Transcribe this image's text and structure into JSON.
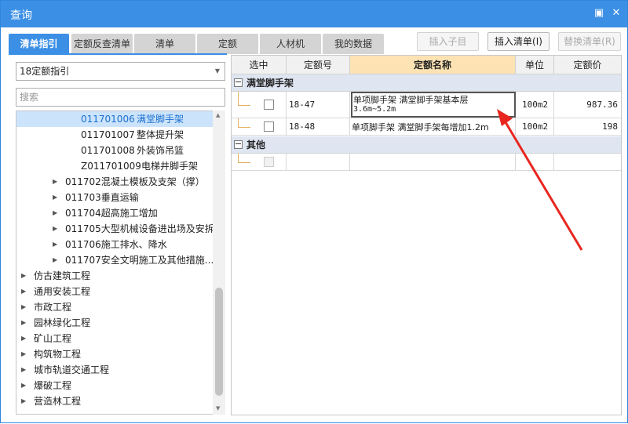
{
  "window": {
    "title": "查询",
    "minimize_icon": "minimize-icon",
    "close_icon": "close-icon"
  },
  "tabs": [
    {
      "label": "清单指引",
      "active": true
    },
    {
      "label": "定额反查清单",
      "active": false
    },
    {
      "label": "清单",
      "active": false
    },
    {
      "label": "定额",
      "active": false
    },
    {
      "label": "人材机",
      "active": false
    },
    {
      "label": "我的数据",
      "active": false
    }
  ],
  "actions": {
    "insert_child": "插入子目",
    "insert_list": "插入清单(I)",
    "replace_list": "替换清单(R)"
  },
  "left": {
    "select_value": "18定额指引",
    "search_placeholder": "搜索",
    "tree": [
      {
        "code": "011701006",
        "name": "满堂脚手架",
        "selected": true,
        "leaf": true
      },
      {
        "code": "011701007",
        "name": "整体提升架",
        "leaf": true
      },
      {
        "code": "011701008",
        "name": "外装饰吊篮",
        "leaf": true
      },
      {
        "code": "Z011701009",
        "name": "电梯井脚手架",
        "leaf": true
      },
      {
        "label": "011702混凝土模板及支架（撑）"
      },
      {
        "label": "011703垂直运输"
      },
      {
        "label": "011704超高施工增加"
      },
      {
        "label": "011705大型机械设备进出场及安拆"
      },
      {
        "label": "011706施工排水、降水"
      },
      {
        "label": "011707安全文明施工及其他措施..."
      },
      {
        "label": "仿古建筑工程"
      },
      {
        "label": "通用安装工程"
      },
      {
        "label": "市政工程"
      },
      {
        "label": "园林绿化工程"
      },
      {
        "label": "矿山工程"
      },
      {
        "label": "构筑物工程"
      },
      {
        "label": "城市轨道交通工程"
      },
      {
        "label": "爆破工程"
      },
      {
        "label": "营造林工程"
      }
    ]
  },
  "grid": {
    "headers": [
      "选中",
      "定额号",
      "定额名称",
      "单位",
      "定额价"
    ],
    "groups": [
      {
        "name": "满堂脚手架",
        "rows": [
          {
            "code": "18-47",
            "name_line1": "单项脚手架 满堂脚手架基本层",
            "name_line2": "3.6m~5.2m",
            "unit": "100m2",
            "price": "987.36"
          },
          {
            "code": "18-48",
            "name_line1": "单项脚手架 满堂脚手架每增加1.2m",
            "unit": "100m2",
            "price": "198"
          }
        ]
      },
      {
        "name": "其他",
        "rows": [
          {
            "code": "",
            "name_line1": "",
            "unit": "",
            "price": ""
          }
        ]
      }
    ]
  },
  "colors": {
    "accent": "#3b8fe5",
    "group_bg": "#dfe6f2",
    "header_highlight": "#fde3b3",
    "arrow": "#e8261f"
  }
}
